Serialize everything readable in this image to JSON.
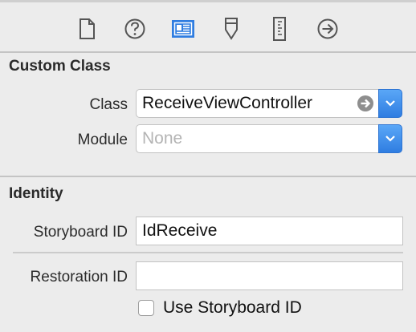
{
  "toolbar": {
    "icons": [
      "file-inspector-icon",
      "help-icon",
      "identity-inspector-icon",
      "attributes-inspector-icon",
      "size-inspector-icon",
      "connections-inspector-icon"
    ],
    "selected_color": "#2f7de1"
  },
  "custom_class": {
    "title": "Custom Class",
    "class_label": "Class",
    "class_value": "ReceiveViewController",
    "module_label": "Module",
    "module_placeholder": "None"
  },
  "identity": {
    "title": "Identity",
    "storyboard_id_label": "Storyboard ID",
    "storyboard_id_value": "IdReceive",
    "restoration_id_label": "Restoration ID",
    "restoration_id_value": "",
    "use_storyboard_id_label": "Use Storyboard ID",
    "use_storyboard_id_checked": false
  }
}
